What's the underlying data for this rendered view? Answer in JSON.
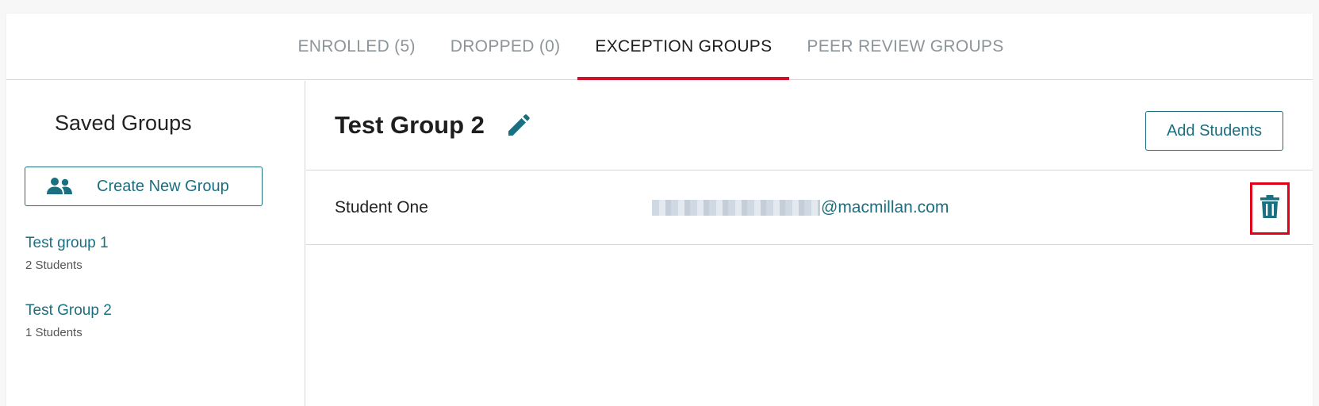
{
  "tabs": [
    {
      "label": "ENROLLED (5)",
      "active": false
    },
    {
      "label": "DROPPED (0)",
      "active": false
    },
    {
      "label": "EXCEPTION GROUPS",
      "active": true
    },
    {
      "label": "PEER REVIEW GROUPS",
      "active": false
    }
  ],
  "sidebar": {
    "title": "Saved Groups",
    "create_button_label": "Create New Group",
    "create_button_icon": "users-icon",
    "groups": [
      {
        "name": "Test group 1",
        "count": "2 Students"
      },
      {
        "name": "Test Group 2",
        "count": "1 Students"
      }
    ]
  },
  "main": {
    "group_title": "Test Group 2",
    "edit_icon": "pencil-icon",
    "add_button_label": "Add Students",
    "students": [
      {
        "name": "Student One",
        "email_domain": "@macmillan.com"
      }
    ],
    "delete_icon": "trash-icon"
  },
  "colors": {
    "accent": "#1a6f80",
    "active_tab_underline": "#d0112b",
    "highlight_box": "#e0001a"
  }
}
